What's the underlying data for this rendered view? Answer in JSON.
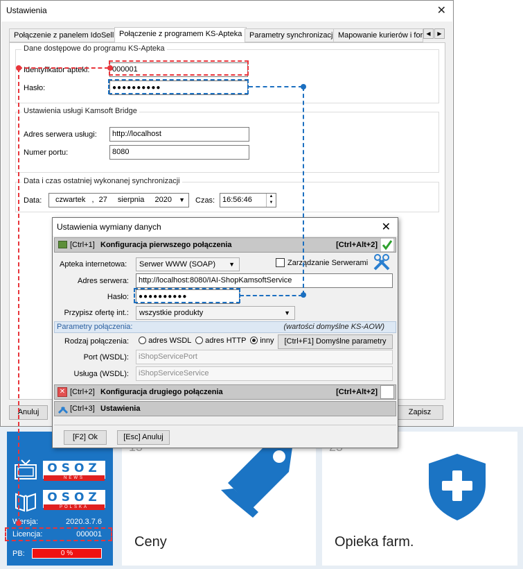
{
  "main_window": {
    "title": "Ustawienia",
    "close": "✕",
    "tabs": [
      "Połączenie z panelem IdoSell",
      "Połączenie z programem KS-Apteka",
      "Parametry synchronizacji",
      "Mapowanie kurierów i form"
    ],
    "group_access": {
      "label": "Dane dostępowe do programu KS-Apteka",
      "id_label": "Identyfikator apteki:",
      "id_value": "000001",
      "pass_label": "Hasło:",
      "pass_value": "●●●●●●●●●●"
    },
    "group_bridge": {
      "label": "Ustawienia usługi Kamsoft Bridge",
      "server_label": "Adres serwera usługi:",
      "server_value": "http://localhost",
      "port_label": "Numer portu:",
      "port_value": "8080"
    },
    "group_sync": {
      "label": "Data i czas ostatniej wykonanej synchronizacji",
      "date_label": "Data:",
      "day_name": "czwartek",
      "day": "27",
      "month": "sierpnia",
      "year": "2020",
      "time_label": "Czas:",
      "time_value": "16:56:46"
    },
    "cancel": "Anuluj",
    "save": "Zapisz"
  },
  "dialog": {
    "title": "Ustawienia wymiany danych",
    "close": "✕",
    "section1": {
      "shortcut": "[Ctrl+1]",
      "title": "Konfiguracja pierwszego połączenia",
      "hotkey": "[Ctrl+Alt+2]"
    },
    "apteka_label": "Apteka internetowa:",
    "apteka_value": "Serwer WWW (SOAP)",
    "manage_servers": "Zarządzanie Serwerami",
    "server_label": "Adres serwera:",
    "server_value": "http://localhost:8080/IAI-ShopKamsoftService",
    "pass_label": "Hasło:",
    "pass_value": "●●●●●●●●●●",
    "offer_label": "Przypisz ofertę int.:",
    "offer_value": "wszystkie produkty",
    "params_label": "Parametry połączenia:",
    "params_note": "(wartości domyślne KS-AOW)",
    "conn_type_label": "Rodzaj połączenia:",
    "conn_options": [
      "adres WSDL",
      "adres HTTP",
      "inny"
    ],
    "default_params": "[Ctrl+F1] Domyślne parametry",
    "port_label": "Port (WSDL):",
    "port_value": "iShopServicePort",
    "service_label": "Usługa (WSDL):",
    "service_value": "iShopServiceService",
    "section2": {
      "shortcut": "[Ctrl+2]",
      "title": "Konfiguracja drugiego połączenia",
      "hotkey": "[Ctrl+Alt+2]"
    },
    "section3": {
      "shortcut": "[Ctrl+3]",
      "title": "Ustawienia"
    },
    "ok": "[F2] Ok",
    "cancel": "[Esc] Anuluj"
  },
  "launcher": {
    "logo1": "OSOZ",
    "logo1_sub": "NEWS",
    "logo2": "OSOZ",
    "logo2_sub": "POLSKA",
    "version_label": "Wersja:",
    "version_value": "2020.3.7.6",
    "license_label": "Licencja:",
    "license_value": "000001",
    "pb_label": "PB:",
    "pb_value": "0 %",
    "pb_progress": 0,
    "tile1_num": "15",
    "tile1_title": "Ceny",
    "tile2_num": "25",
    "tile2_title": "Opieka farm."
  },
  "colors": {
    "annotation_red": "#e8353b",
    "annotation_blue": "#1b6fc0",
    "brand_blue": "#1b74c4"
  }
}
